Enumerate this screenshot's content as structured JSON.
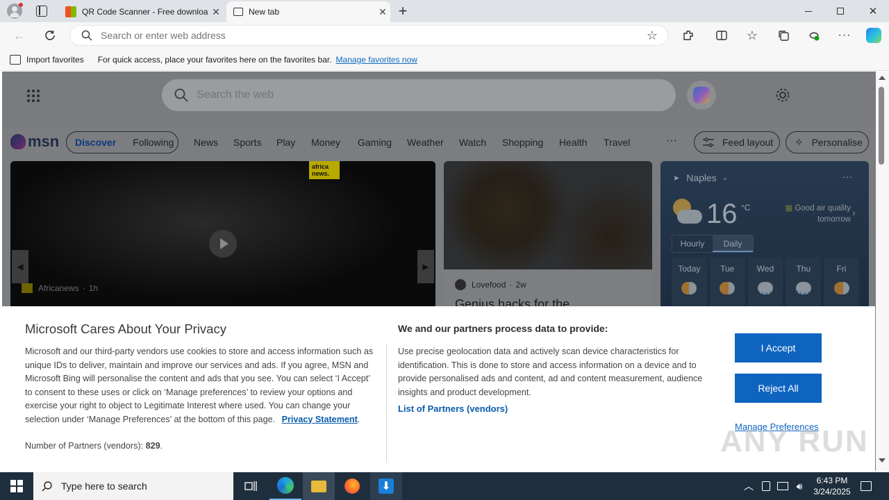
{
  "browser": {
    "tabs": [
      {
        "title": "QR Code Scanner - Free download and install on Windows | Microsoft Store",
        "active": false
      },
      {
        "title": "New tab",
        "active": true
      }
    ],
    "address_placeholder": "Search or enter web address"
  },
  "favorites_bar": {
    "import_label": "Import favorites",
    "hint": "For quick access, place your favorites here on the favorites bar.",
    "manage_link": "Manage favorites now"
  },
  "msn": {
    "search_placeholder": "Search the web",
    "logo_text": "msn",
    "nav_tabs": [
      "Discover",
      "Following"
    ],
    "nav_links": [
      "News",
      "Sports",
      "Play",
      "Money",
      "Gaming",
      "Weather",
      "Watch",
      "Shopping",
      "Health",
      "Travel"
    ],
    "more_label": "···",
    "feed_layout": "Feed layout",
    "personalise": "Personalise",
    "hero": {
      "source": "Africanews",
      "age": "1h",
      "badge": "africa news."
    },
    "story": {
      "source": "Lovefood",
      "age": "2w",
      "headline": "Genius hacks for the"
    },
    "weather": {
      "location": "Naples",
      "temperature": "16",
      "unit": "°C",
      "air_quality": "Good air quality tomorrow",
      "tabs": [
        "Hourly",
        "Daily"
      ],
      "days": [
        "Today",
        "Tue",
        "Wed",
        "Thu",
        "Fri"
      ]
    }
  },
  "privacy": {
    "title": "Microsoft Cares About Your Privacy",
    "body": "Microsoft and our third-party vendors use cookies to store and access information such as unique IDs to deliver, maintain and improve our services and ads. If you agree, MSN and Microsoft Bing will personalise the content and ads that you see. You can select ‘I Accept’ to consent to these uses or click on ‘Manage preferences’ to review your options and exercise your right to object to Legitimate Interest where used.  You can change your selection under ‘Manage Preferences’ at the bottom of this page.",
    "privacy_link": "Privacy Statement",
    "partners_label": "Number of Partners (vendors):",
    "partners_count": "829",
    "right_title": "We and our partners process data to provide:",
    "right_body": "Use precise geolocation data and actively scan device characteristics for identification. This is done to store and access information on a device and to provide personalised ads and content, ad and content measurement, audience insights and product development.",
    "partners_link": "List of Partners (vendors)",
    "accept": "I Accept",
    "reject": "Reject All",
    "manage": "Manage Preferences"
  },
  "taskbar": {
    "search_placeholder": "Type here to search",
    "time": "6:43 PM",
    "date": "3/24/2025"
  },
  "watermark": "ANY RUN"
}
